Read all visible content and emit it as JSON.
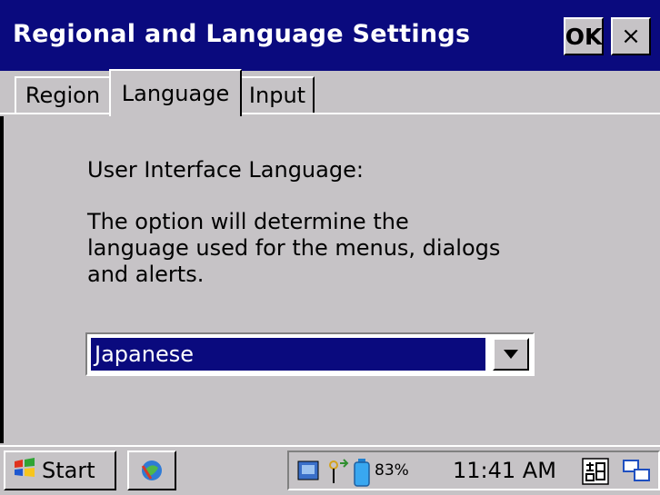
{
  "window": {
    "title": "Regional and Language Settings",
    "ok_label": "OK",
    "close_label": "×"
  },
  "tabs": [
    {
      "label": "Region",
      "active": false
    },
    {
      "label": "Language",
      "active": true
    },
    {
      "label": "Input",
      "active": false
    }
  ],
  "content": {
    "section_label": "User Interface Language:",
    "description": "The option will determine the language used for the menus, dialogs and alerts.",
    "language_select": {
      "selected": "Japanese"
    }
  },
  "taskbar": {
    "start_label": "Start",
    "battery_percent": "83%",
    "clock": "11:41 AM",
    "icons": [
      "windows-flag-icon",
      "app-icon",
      "network-icon",
      "signal-icon",
      "battery-icon",
      "input-method-icon",
      "connection-icon"
    ]
  },
  "colors": {
    "titlebar": "#0a0a7e",
    "face": "#c6c3c6",
    "selection": "#0a0a7e"
  }
}
